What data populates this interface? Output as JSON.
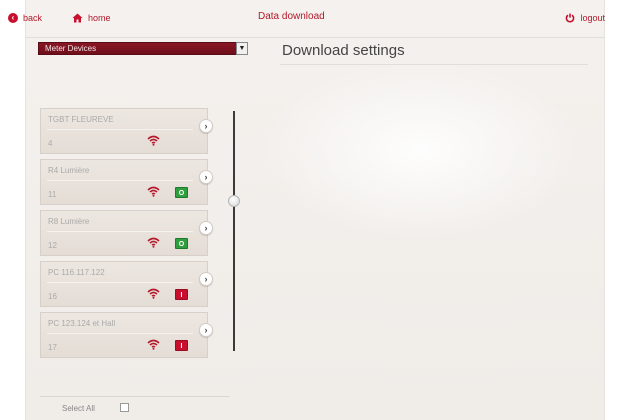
{
  "header": {
    "back_label": "back",
    "home_label": "home",
    "title": "Data download",
    "logout_label": "logout"
  },
  "device_select": {
    "value": "Meter Devices"
  },
  "main": {
    "section_title": "Download settings"
  },
  "devices": [
    {
      "name": "TGBT FLEUREVE",
      "id": "4",
      "status": ""
    },
    {
      "name": "R4 Lumière",
      "id": "11",
      "status": "O"
    },
    {
      "name": "R8 Lumière",
      "id": "12",
      "status": "O"
    },
    {
      "name": "PC 116.117.122",
      "id": "16",
      "status": "I"
    },
    {
      "name": "PC 123.124 et Hall",
      "id": "17",
      "status": "I"
    }
  ],
  "footer": {
    "select_all_label": "Select All"
  },
  "colors": {
    "accent": "#b3192b",
    "status_on": "#2e9e3e",
    "status_off": "#c8102e"
  },
  "icons": {
    "back": "back-arrow-icon",
    "home": "home-icon",
    "logout": "power-icon",
    "signal": "wifi-icon",
    "card_arrow": "chevron-right-icon"
  }
}
